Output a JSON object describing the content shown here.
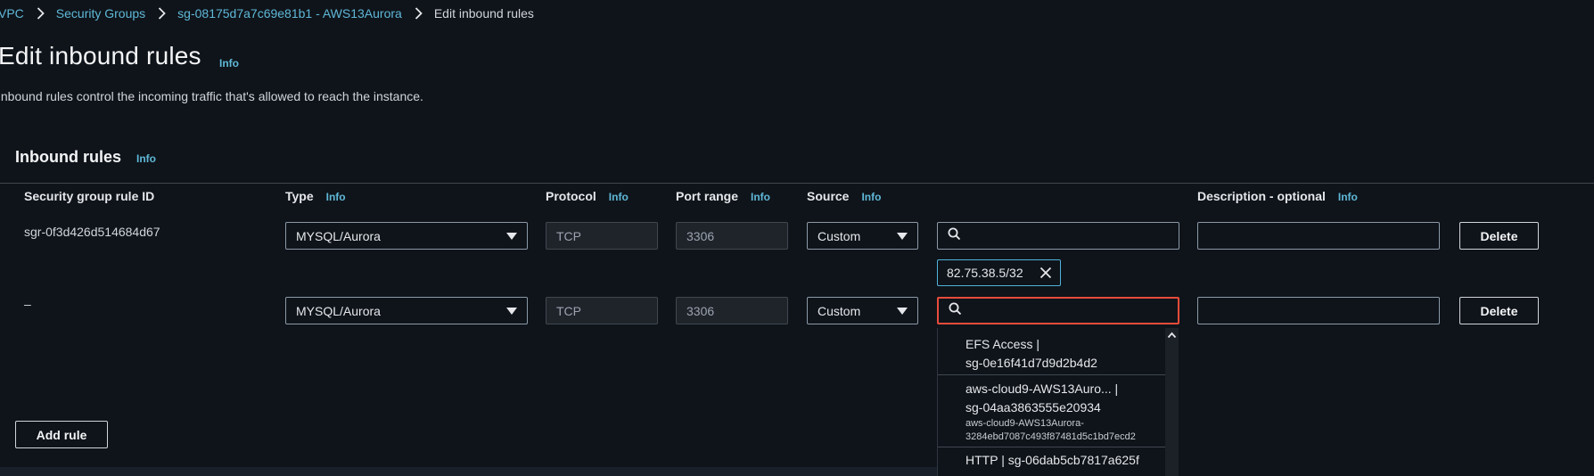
{
  "breadcrumb": {
    "items": [
      "VPC",
      "Security Groups",
      "sg-08175d7a7c69e81b1 - AWS13Aurora"
    ],
    "current": "Edit inbound rules"
  },
  "header": {
    "title": "Edit inbound rules",
    "info": "Info",
    "description": "Inbound rules control the incoming traffic that's allowed to reach the instance."
  },
  "panel": {
    "title": "Inbound rules",
    "info": "Info",
    "columns": [
      {
        "label": "Security group rule ID",
        "info": ""
      },
      {
        "label": "Type",
        "info": "Info"
      },
      {
        "label": "Protocol",
        "info": "Info"
      },
      {
        "label": "Port range",
        "info": "Info"
      },
      {
        "label": "Source",
        "info": "Info"
      },
      {
        "label": "Description - optional",
        "info": "Info"
      }
    ],
    "rows": [
      {
        "rule_id": "sgr-0f3d426d514684d67",
        "type": "MYSQL/Aurora",
        "protocol": "TCP",
        "port": "3306",
        "source": "Custom",
        "delete": "Delete"
      },
      {
        "rule_id": "–",
        "type": "MYSQL/Aurora",
        "protocol": "TCP",
        "port": "3306",
        "source": "Custom",
        "delete": "Delete"
      }
    ],
    "token": "82.75.38.5/32",
    "add_rule": "Add rule"
  },
  "dropdown": {
    "options": [
      {
        "line1": "EFS Access |",
        "line2": "sg-0e16f41d7d9d2b4d2"
      },
      {
        "line1": "aws-cloud9-AWS13Auro... |",
        "line2": "sg-04aa3863555e20934",
        "sub1": "aws-cloud9-AWS13Aurora-",
        "sub2": "3284ebd7087c493f87481d5c1bd7ecd2"
      },
      {
        "line1": "HTTP | sg-06dab5cb7817a625f"
      }
    ]
  },
  "colors": {
    "background": "#0f141a",
    "link": "#5fb8d8",
    "error_border": "#e74c3c",
    "token_border": "#4fb3d9"
  },
  "icons": [
    "chevron-right-icon",
    "search-icon",
    "close-icon",
    "caret-down-icon",
    "chevron-up-icon"
  ]
}
